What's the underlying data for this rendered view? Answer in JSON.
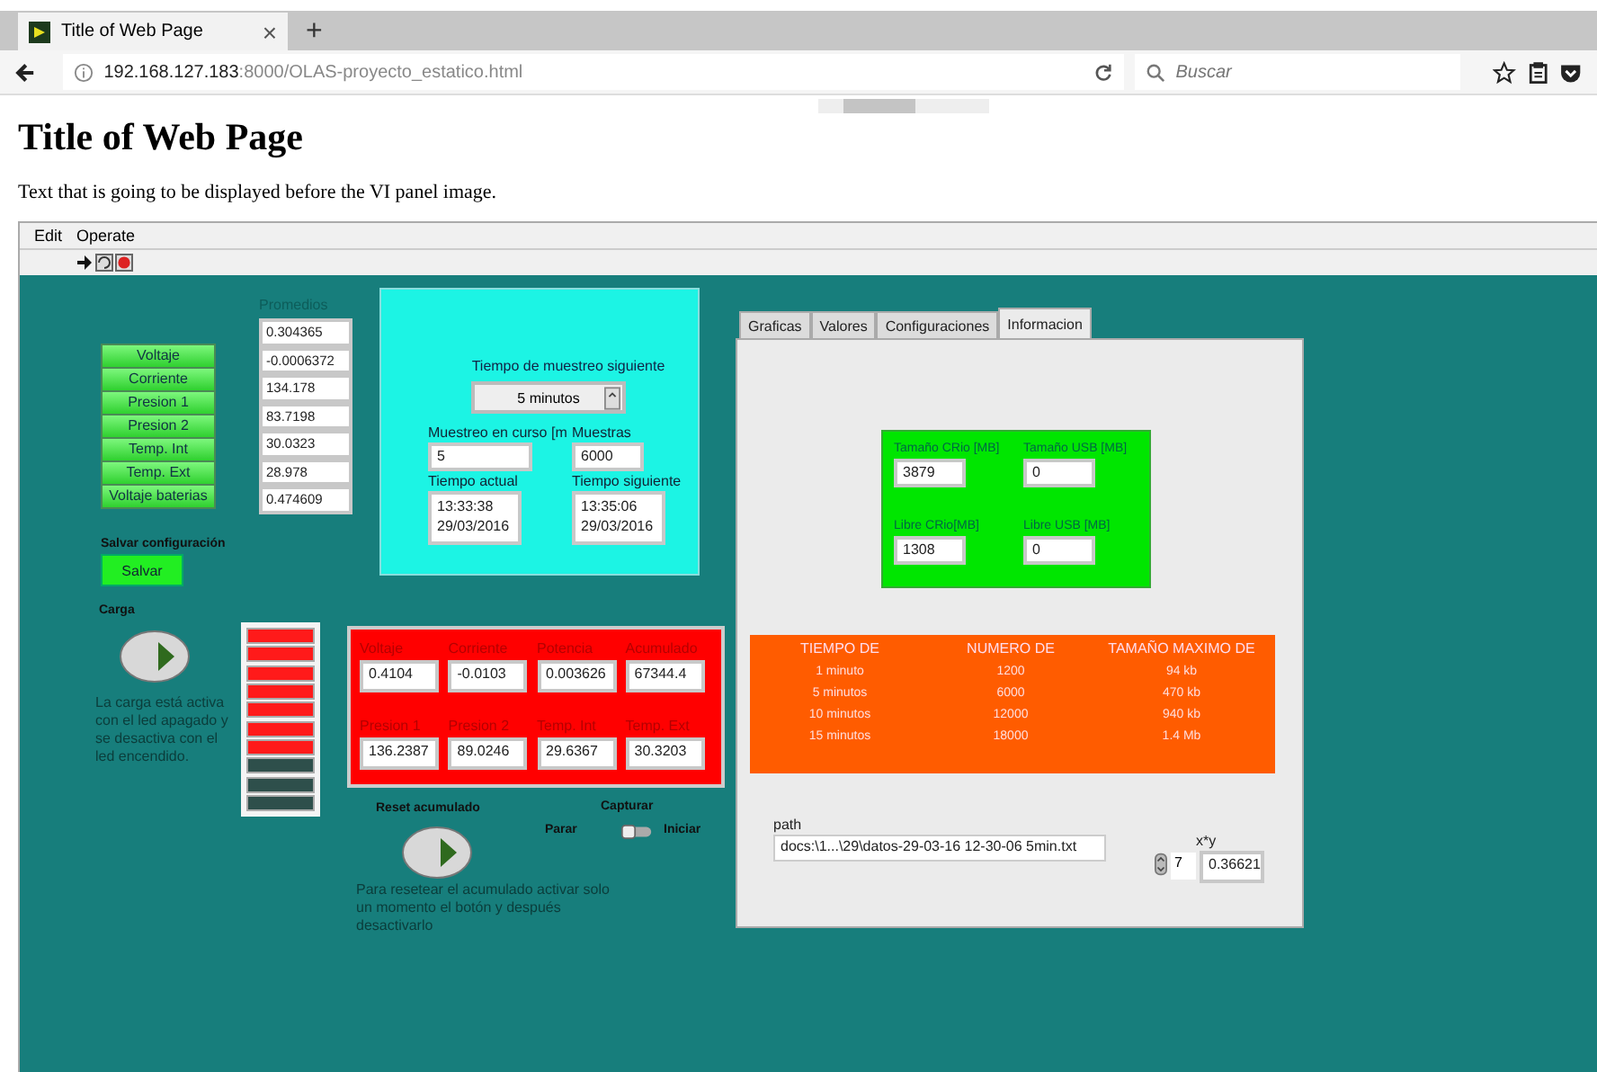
{
  "browser": {
    "tab_title": "Title of Web Page",
    "close": "×",
    "new_tab": "+",
    "url_host": "192.168.127.183",
    "url_rest": ":8000/OLAS-proyecto_estatico.html",
    "search_placeholder": "Buscar"
  },
  "page": {
    "heading": "Title of Web Page",
    "intro": "Text that is going to be displayed before the VI panel image."
  },
  "vi": {
    "menu": [
      "Edit",
      "Operate"
    ],
    "averages": {
      "label": "Promedios",
      "channels": [
        {
          "name": "Voltaje",
          "value": "0.304365"
        },
        {
          "name": "Corriente",
          "value": "-0.0006372"
        },
        {
          "name": "Presion 1",
          "value": "134.178"
        },
        {
          "name": "Presion 2",
          "value": "83.7198"
        },
        {
          "name": "Temp. Int",
          "value": "30.0323"
        },
        {
          "name": "Temp. Ext",
          "value": "28.978"
        },
        {
          "name": "Voltaje baterias",
          "value": "0.474609"
        }
      ]
    },
    "save": {
      "label": "Salvar configuración",
      "button": "Salvar"
    },
    "load": {
      "label": "Carga",
      "description": "La carga está activa con el led apagado y se desactiva con el led encendido."
    },
    "leds": [
      {
        "on": true
      },
      {
        "on": true
      },
      {
        "on": true
      },
      {
        "on": true
      },
      {
        "on": true
      },
      {
        "on": true
      },
      {
        "on": true
      },
      {
        "on": false
      },
      {
        "on": false
      },
      {
        "on": false
      }
    ],
    "sampling": {
      "title": "Tiempo de muestreo siguiente",
      "interval": "5 minutos",
      "current_label": "Muestreo en curso [m",
      "current": "5",
      "samples_label": "Muestras",
      "samples": "6000",
      "now_label": "Tiempo actual",
      "now": [
        "13:33:38",
        "29/03/2016"
      ],
      "next_label": "Tiempo siguiente",
      "next": [
        "13:35:06",
        "29/03/2016"
      ]
    },
    "power": {
      "fields": [
        {
          "label": "Voltaje",
          "value": "0.4104"
        },
        {
          "label": "Corriente",
          "value": "-0.0103"
        },
        {
          "label": "Potencia",
          "value": "0.003626"
        },
        {
          "label": "Acumulado",
          "value": "67344.4"
        },
        {
          "label": "Presion 1",
          "value": "136.2387"
        },
        {
          "label": "Presion 2",
          "value": "89.0246"
        },
        {
          "label": "Temp. Int",
          "value": "29.6367"
        },
        {
          "label": "Temp. Ext",
          "value": "30.3203"
        }
      ]
    },
    "reset": {
      "label": "Reset acumulado",
      "description": "Para resetear el acumulado activar solo un momento el botón y después desactivarlo"
    },
    "capture": {
      "label": "Capturar",
      "off_label": "Parar",
      "on_label": "Iniciar",
      "on": false
    },
    "tabs": [
      {
        "label": "Graficas",
        "selected": false
      },
      {
        "label": "Valores",
        "selected": false
      },
      {
        "label": "Configuraciones",
        "selected": false
      },
      {
        "label": "Informacion",
        "selected": true
      }
    ],
    "info": {
      "storage": [
        {
          "label": "Tamaño CRio [MB]",
          "value": "3879"
        },
        {
          "label": "Tamaño USB [MB]",
          "value": "0"
        },
        {
          "label": "Libre CRio[MB]",
          "value": "1308"
        },
        {
          "label": "Libre USB [MB]",
          "value": "0"
        }
      ],
      "table": {
        "columns": [
          "TIEMPO DE",
          "NUMERO DE",
          "TAMAÑO MAXIMO DE"
        ],
        "rows": [
          [
            "1 minuto",
            "1200",
            "94 kb"
          ],
          [
            "5 minutos",
            "6000",
            "470 kb"
          ],
          [
            "10 minutos",
            "12000",
            "940 kb"
          ],
          [
            "15 minutos",
            "18000",
            "1.4 Mb"
          ]
        ]
      },
      "path": {
        "label": "path",
        "value": "docs:\\1...\\29\\datos-29-03-16  12-30-06 5min.txt"
      },
      "xy": {
        "label": "x*y",
        "index": "7",
        "value": "0.36621"
      }
    }
  }
}
